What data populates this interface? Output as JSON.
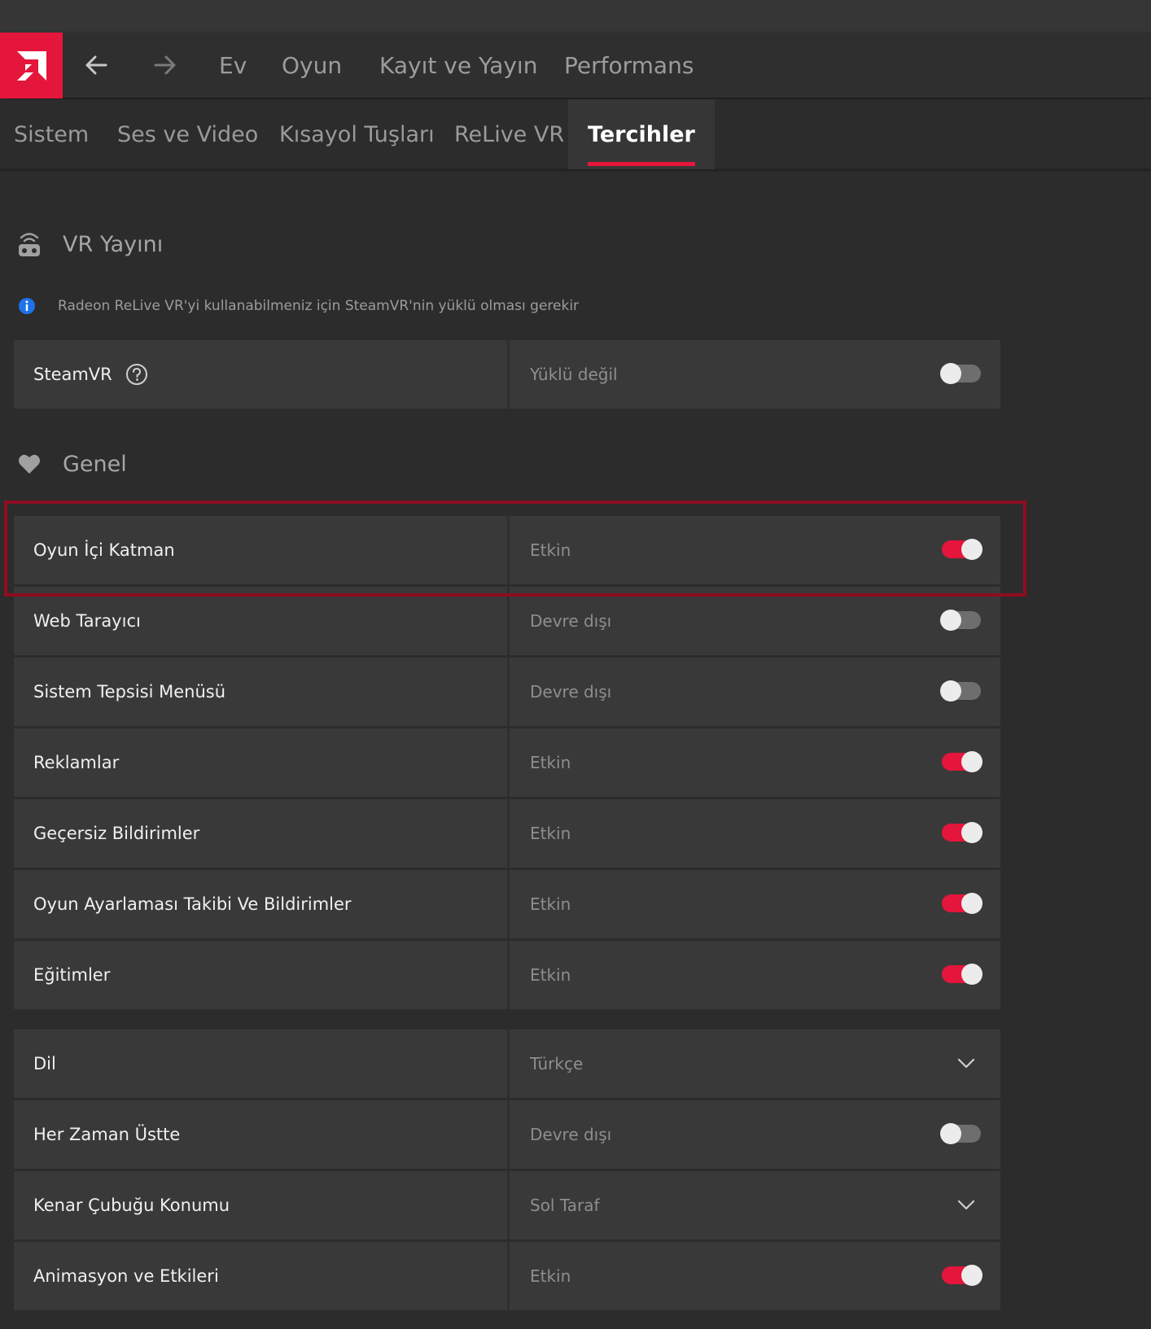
{
  "nav": {
    "items": [
      "Ev",
      "Oyun",
      "Kayıt ve Yayın",
      "Performans"
    ]
  },
  "subnav": {
    "tabs": [
      "Sistem",
      "Ses ve Video",
      "Kısayol Tuşları",
      "ReLive VR",
      "Tercihler"
    ],
    "active": "Tercihler"
  },
  "vr_section": {
    "title": "VR Yayını",
    "info": "Radeon ReLive VR'yi kullanabilmeniz için SteamVR'nin yüklü olması gerekir",
    "steamvr": {
      "label": "SteamVR",
      "value": "Yüklü değil",
      "enabled": false
    }
  },
  "general_section": {
    "title": "Genel",
    "rows": [
      {
        "label": "Oyun İçi Katman",
        "value": "Etkin",
        "enabled": true
      },
      {
        "label": "Web Tarayıcı",
        "value": "Devre dışı",
        "enabled": false
      },
      {
        "label": "Sistem Tepsisi Menüsü",
        "value": "Devre dışı",
        "enabled": false
      },
      {
        "label": "Reklamlar",
        "value": "Etkin",
        "enabled": true
      },
      {
        "label": "Geçersiz Bildirimler",
        "value": "Etkin",
        "enabled": true
      },
      {
        "label": "Oyun Ayarlaması Takibi Ve Bildirimler",
        "value": "Etkin",
        "enabled": true
      },
      {
        "label": "Eğitimler",
        "value": "Etkin",
        "enabled": true
      }
    ],
    "rows2": [
      {
        "label": "Dil",
        "value": "Türkçe",
        "type": "dropdown"
      },
      {
        "label": "Her Zaman Üstte",
        "value": "Devre dışı",
        "enabled": false
      },
      {
        "label": "Kenar Çubuğu Konumu",
        "value": "Sol Taraf",
        "type": "dropdown"
      },
      {
        "label": "Animasyon ve Etkileri",
        "value": "Etkin",
        "enabled": true
      }
    ]
  },
  "colors": {
    "accent": "#e4163c",
    "highlight_border": "#8f0d22",
    "info_icon": "#1e73e8"
  }
}
